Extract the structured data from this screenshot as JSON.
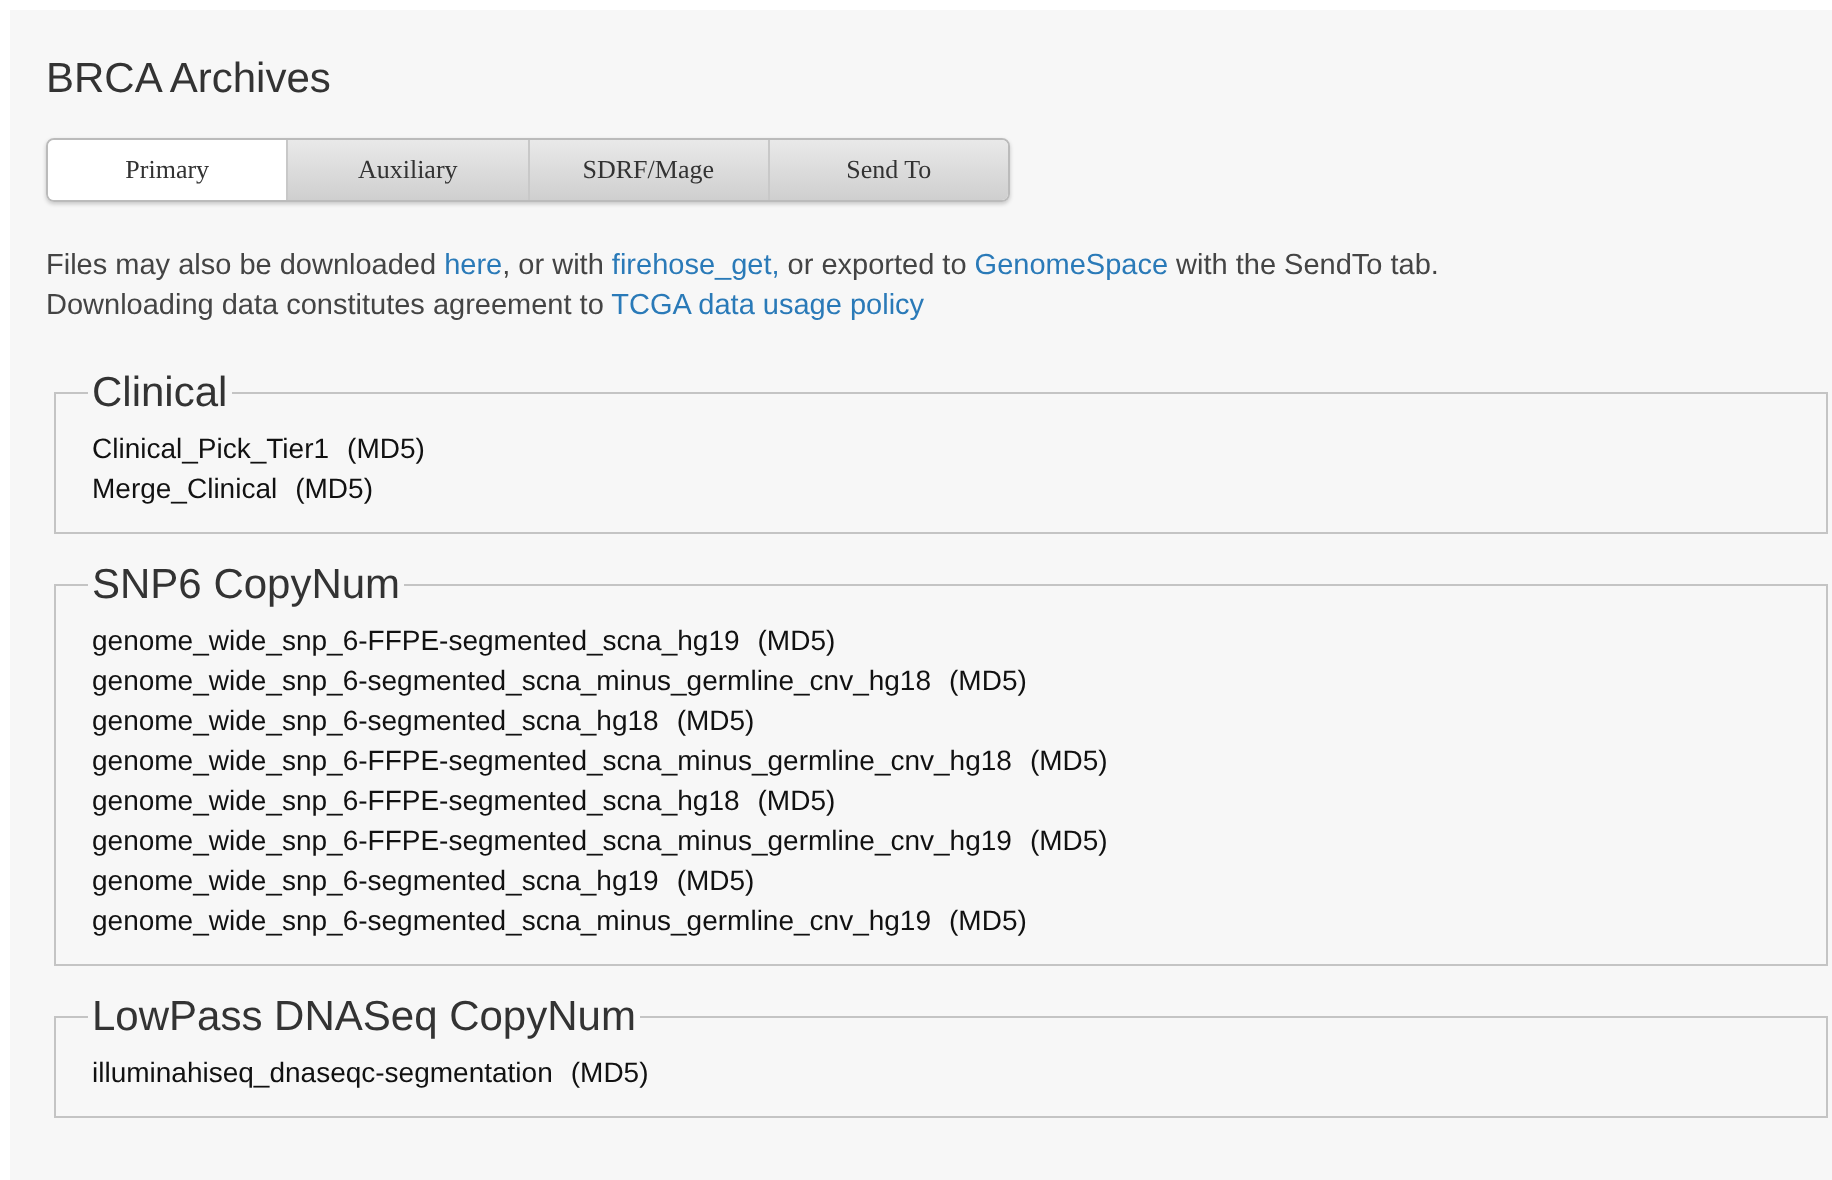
{
  "title": "BRCA Archives",
  "tabs": [
    {
      "label": "Primary",
      "selected": true
    },
    {
      "label": "Auxiliary",
      "selected": false
    },
    {
      "label": "SDRF/Mage",
      "selected": false
    },
    {
      "label": "Send To",
      "selected": false
    }
  ],
  "description": [
    [
      {
        "text": "Files may also be downloaded "
      },
      {
        "link": "here"
      },
      {
        "text": ", or with "
      },
      {
        "link": "firehose_get,"
      },
      {
        "text": " or exported to "
      },
      {
        "link": "GenomeSpace"
      },
      {
        "text": " with the SendTo tab."
      }
    ],
    [
      {
        "text": "Downloading data constitutes agreement to "
      },
      {
        "link": "TCGA data usage policy"
      }
    ]
  ],
  "sections": [
    {
      "legend": "Clinical",
      "files": [
        {
          "name": "Clinical_Pick_Tier1",
          "checksum": "(MD5)"
        },
        {
          "name": "Merge_Clinical",
          "checksum": "(MD5)"
        }
      ]
    },
    {
      "legend": "SNP6 CopyNum",
      "files": [
        {
          "name": "genome_wide_snp_6-FFPE-segmented_scna_hg19",
          "checksum": "(MD5)"
        },
        {
          "name": "genome_wide_snp_6-segmented_scna_minus_germline_cnv_hg18",
          "checksum": "(MD5)"
        },
        {
          "name": "genome_wide_snp_6-segmented_scna_hg18",
          "checksum": "(MD5)"
        },
        {
          "name": "genome_wide_snp_6-FFPE-segmented_scna_minus_germline_cnv_hg18",
          "checksum": "(MD5)"
        },
        {
          "name": "genome_wide_snp_6-FFPE-segmented_scna_hg18",
          "checksum": "(MD5)"
        },
        {
          "name": "genome_wide_snp_6-FFPE-segmented_scna_minus_germline_cnv_hg19",
          "checksum": "(MD5)"
        },
        {
          "name": "genome_wide_snp_6-segmented_scna_hg19",
          "checksum": "(MD5)"
        },
        {
          "name": "genome_wide_snp_6-segmented_scna_minus_germline_cnv_hg19",
          "checksum": "(MD5)"
        }
      ]
    },
    {
      "legend": "LowPass DNASeq CopyNum",
      "files": [
        {
          "name": "illuminahiseq_dnaseqc-segmentation",
          "checksum": "(MD5)"
        }
      ]
    }
  ]
}
